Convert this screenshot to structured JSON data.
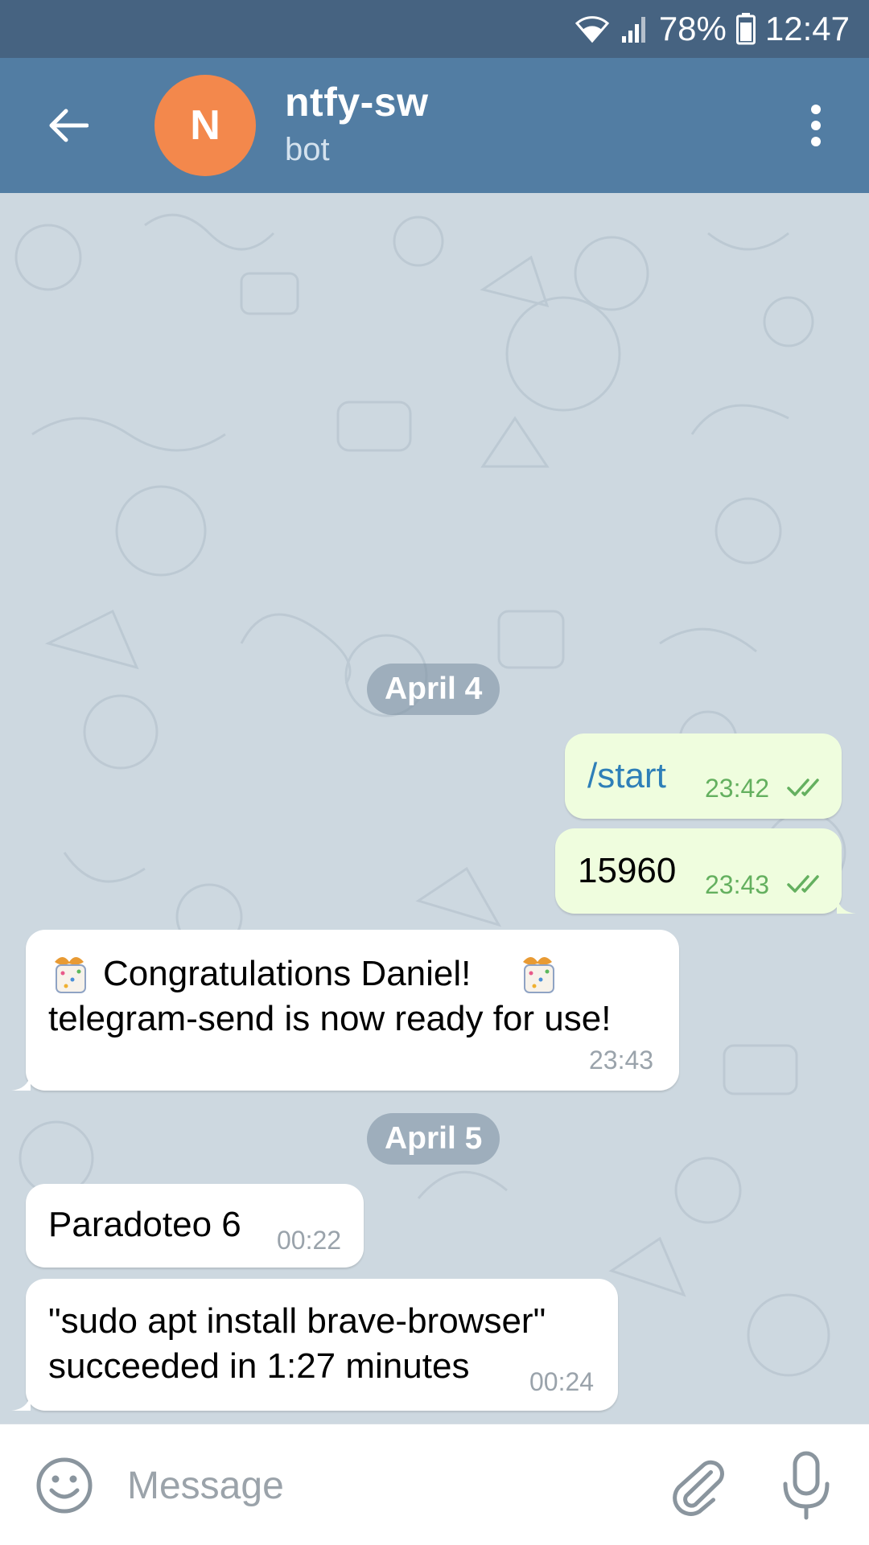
{
  "status_bar": {
    "battery": "78%",
    "time": "12:47",
    "icons": [
      "wifi-icon",
      "signal-icon",
      "battery-icon"
    ]
  },
  "header": {
    "avatar_letter": "N",
    "avatar_color": "#f3884c",
    "title": "ntfy-sw",
    "subtitle": "bot",
    "icons": [
      "back-arrow-icon",
      "more-vertical-icon"
    ]
  },
  "chat": {
    "dates": [
      "April 4",
      "April 5"
    ],
    "messages": [
      {
        "direction": "out",
        "text": "/start",
        "time": "23:42",
        "read": true
      },
      {
        "direction": "out",
        "text": "15960",
        "time": "23:43",
        "read": true
      },
      {
        "direction": "in",
        "lines": [
          "Congratulations Daniel!",
          "telegram-send is now ready for use!"
        ],
        "time": "23:43",
        "emoji": "party-popper-icon"
      },
      {
        "direction": "in",
        "text": "Paradoteo 6",
        "time": "00:22"
      },
      {
        "direction": "in",
        "lines": [
          "\"sudo apt install brave-browser\"",
          "succeeded in 1:27 minutes"
        ],
        "time": "00:24"
      }
    ]
  },
  "input": {
    "placeholder": "Message",
    "value": "",
    "icons": [
      "emoji-icon",
      "attach-icon",
      "microphone-icon"
    ]
  },
  "colors": {
    "status_bar": "#466381",
    "app_bar": "#527da3",
    "chat_bg": "#cdd8e0",
    "outgoing_bubble": "#effdde",
    "incoming_bubble": "#ffffff",
    "read_ticks": "#64b05f"
  }
}
